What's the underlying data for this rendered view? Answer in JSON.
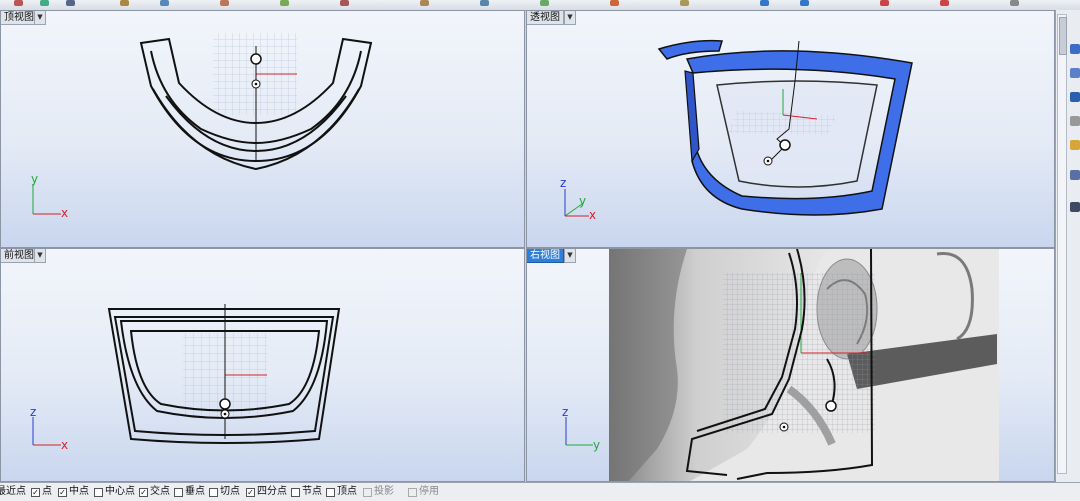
{
  "viewports": {
    "top": {
      "label": "顶视图"
    },
    "perspective": {
      "label": "透视图"
    },
    "front": {
      "label": "前视图"
    },
    "right": {
      "label": "右视图"
    }
  },
  "axes": {
    "x": "x",
    "y": "y",
    "z": "z"
  },
  "osnap": {
    "items": [
      {
        "label": "最近点",
        "checked": null
      },
      {
        "label": "点",
        "checked": true
      },
      {
        "label": "中点",
        "checked": true
      },
      {
        "label": "中心点",
        "checked": false
      },
      {
        "label": "交点",
        "checked": true
      },
      {
        "label": "垂点",
        "checked": false
      },
      {
        "label": "切点",
        "checked": false
      },
      {
        "label": "四分点",
        "checked": true
      },
      {
        "label": "节点",
        "checked": false
      },
      {
        "label": "顶点",
        "checked": false
      },
      {
        "label": "投影",
        "checked": false,
        "disabled": true
      },
      {
        "label": "停用",
        "checked": false,
        "disabled": true
      }
    ]
  },
  "colors": {
    "accent": "#2f7fd8",
    "shield_blue": "#3f6fe8",
    "x_axis": "#d8202a",
    "y_axis": "#22a83a",
    "z_axis": "#2a3ad8"
  }
}
